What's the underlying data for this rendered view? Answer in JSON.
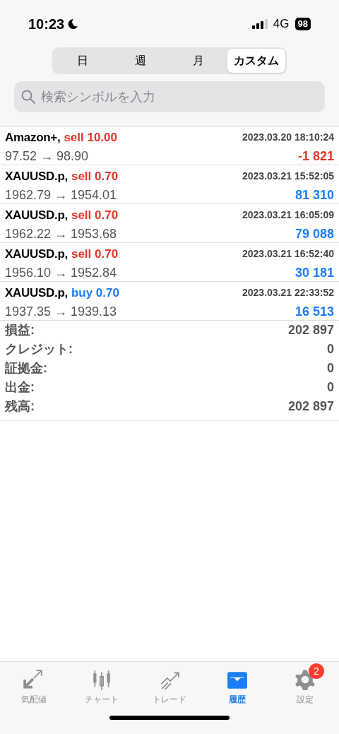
{
  "status_bar": {
    "time": "10:23",
    "network": "4G",
    "battery": "98"
  },
  "period_tabs": [
    {
      "label": "日",
      "selected": false
    },
    {
      "label": "週",
      "selected": false
    },
    {
      "label": "月",
      "selected": false
    },
    {
      "label": "カスタム",
      "selected": true
    }
  ],
  "search": {
    "placeholder": "検索シンボルを入力"
  },
  "deals": [
    {
      "symbol": "Amazon+,",
      "kind": "sell",
      "order": "sell 10.00",
      "time": "2023.03.20 18:10:24",
      "prices": "97.52 → 98.90",
      "profit": "-1 821",
      "color": "#e0372a"
    },
    {
      "symbol": "XAUUSD.p,",
      "kind": "sell",
      "order": "sell 0.70",
      "time": "2023.03.21 15:52:05",
      "prices": "1962.79 → 1954.01",
      "profit": "81 310",
      "color": "#1a7ef5"
    },
    {
      "symbol": "XAUUSD.p,",
      "kind": "sell",
      "order": "sell 0.70",
      "time": "2023.03.21 16:05:09",
      "prices": "1962.22 → 1953.68",
      "profit": "79 088",
      "color": "#1a7ef5"
    },
    {
      "symbol": "XAUUSD.p,",
      "kind": "sell",
      "order": "sell 0.70",
      "time": "2023.03.21 16:52:40",
      "prices": "1956.10 → 1952.84",
      "profit": "30 181",
      "color": "#1a7ef5"
    },
    {
      "symbol": "XAUUSD.p,",
      "kind": "buy",
      "order": "buy 0.70",
      "time": "2023.03.21 22:33:52",
      "prices": "1937.35 → 1939.13",
      "profit": "16 513",
      "color": "#1a7ef5"
    }
  ],
  "summary": [
    {
      "label": "損益:",
      "value": "202 897"
    },
    {
      "label": "クレジット:",
      "value": "0"
    },
    {
      "label": "証拠金:",
      "value": "0"
    },
    {
      "label": "出金:",
      "value": "0"
    },
    {
      "label": "残高:",
      "value": "202 897"
    }
  ],
  "tab_bar": [
    {
      "label": "気配値",
      "selected": false
    },
    {
      "label": "チャート",
      "selected": false
    },
    {
      "label": "トレード",
      "selected": false
    },
    {
      "label": "履歴",
      "selected": true
    },
    {
      "label": "設定",
      "selected": false,
      "badge": "2"
    }
  ]
}
